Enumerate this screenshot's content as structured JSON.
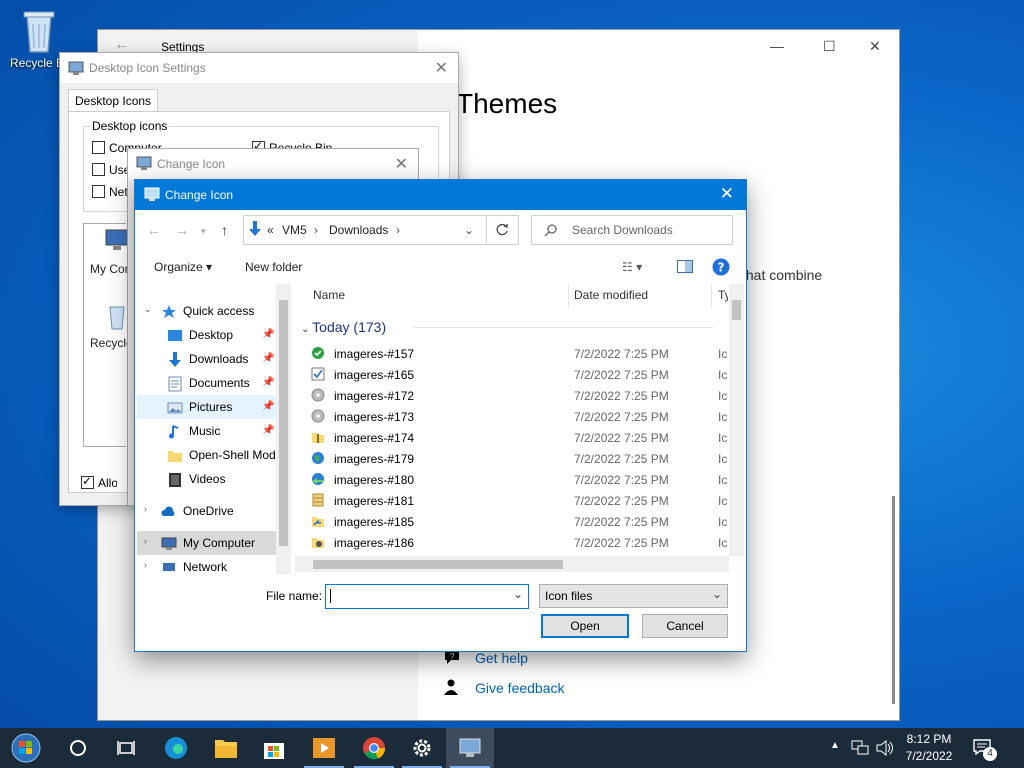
{
  "desktop": {
    "recycle_bin_label": "Recycle Bin"
  },
  "settings": {
    "title": "Settings",
    "heading": "Themes",
    "partial_text": "that combine",
    "links": {
      "help": "Get help",
      "feedback": "Give feedback"
    }
  },
  "desktop_icon_settings": {
    "title": "Desktop Icon Settings",
    "tab": "Desktop Icons",
    "group_label": "Desktop icons",
    "checkboxes": [
      {
        "label": "Computer",
        "checked": false
      },
      {
        "label": "User's Files",
        "checked": false
      },
      {
        "label": "Network",
        "checked": false
      },
      {
        "label": "Recycle Bin",
        "checked": true
      }
    ],
    "icons": [
      {
        "label": "My Computer"
      },
      {
        "label": "Recycle Bin (empty)"
      }
    ],
    "allow_themes_label": "Allow themes to change desktop icons"
  },
  "change_icon_back": {
    "title": "Change Icon"
  },
  "file_dialog": {
    "title": "Change Icon",
    "breadcrumb": {
      "overflow": "«",
      "segments": [
        "VM5",
        "Downloads"
      ]
    },
    "search_placeholder": "Search Downloads",
    "toolbar": {
      "organize": "Organize",
      "new_folder": "New folder"
    },
    "nav_tree": [
      {
        "label": "Quick access",
        "icon": "star-icon",
        "level": "top",
        "expand": "v"
      },
      {
        "label": "Desktop",
        "icon": "desktop-folder-icon",
        "pinned": true
      },
      {
        "label": "Downloads",
        "icon": "downloads-folder-icon",
        "pinned": true
      },
      {
        "label": "Documents",
        "icon": "documents-folder-icon",
        "pinned": true
      },
      {
        "label": "Pictures",
        "icon": "pictures-folder-icon",
        "pinned": true,
        "selected": true
      },
      {
        "label": "Music",
        "icon": "music-folder-icon",
        "pinned": true
      },
      {
        "label": "Open-Shell Mod",
        "icon": "folder-icon",
        "pinned": false
      },
      {
        "label": "Videos",
        "icon": "videos-folder-icon",
        "pinned": false
      },
      {
        "label": "OneDrive",
        "icon": "cloud-icon",
        "level": "top",
        "expand": ">"
      },
      {
        "label": "My Computer",
        "icon": "computer-icon",
        "level": "top",
        "expand": ">",
        "hover": true
      },
      {
        "label": "Network",
        "icon": "network-icon",
        "level": "top",
        "expand": ">"
      }
    ],
    "columns": {
      "name": "Name",
      "date": "Date modified",
      "type": "Type"
    },
    "group_header": "Today (173)",
    "files": [
      {
        "name": "imageres-#157",
        "date": "7/2/2022 7:25 PM",
        "type": "Icon",
        "icon": "green-check-icon"
      },
      {
        "name": "imageres-#165",
        "date": "7/2/2022 7:25 PM",
        "type": "Icon",
        "icon": "checkbox-icon"
      },
      {
        "name": "imageres-#172",
        "date": "7/2/2022 7:25 PM",
        "type": "Icon",
        "icon": "disc-icon"
      },
      {
        "name": "imageres-#173",
        "date": "7/2/2022 7:25 PM",
        "type": "Icon",
        "icon": "disc-icon"
      },
      {
        "name": "imageres-#174",
        "date": "7/2/2022 7:25 PM",
        "type": "Icon",
        "icon": "zip-folder-icon"
      },
      {
        "name": "imageres-#179",
        "date": "7/2/2022 7:25 PM",
        "type": "Icon",
        "icon": "globe-icon"
      },
      {
        "name": "imageres-#180",
        "date": "7/2/2022 7:25 PM",
        "type": "Icon",
        "icon": "globe-arrow-icon"
      },
      {
        "name": "imageres-#181",
        "date": "7/2/2022 7:25 PM",
        "type": "Icon",
        "icon": "file-cabinet-icon"
      },
      {
        "name": "imageres-#185",
        "date": "7/2/2022 7:25 PM",
        "type": "Icon",
        "icon": "folder-shortcut-icon"
      },
      {
        "name": "imageres-#186",
        "date": "7/2/2022 7:25 PM",
        "type": "Icon",
        "icon": "folder-gear-icon"
      }
    ],
    "file_name_label": "File name:",
    "file_name_value": "",
    "file_type": "Icon files",
    "open_label": "Open",
    "cancel_label": "Cancel"
  },
  "taskbar": {
    "time": "8:12 PM",
    "date": "7/2/2022",
    "notification_count": "4"
  }
}
